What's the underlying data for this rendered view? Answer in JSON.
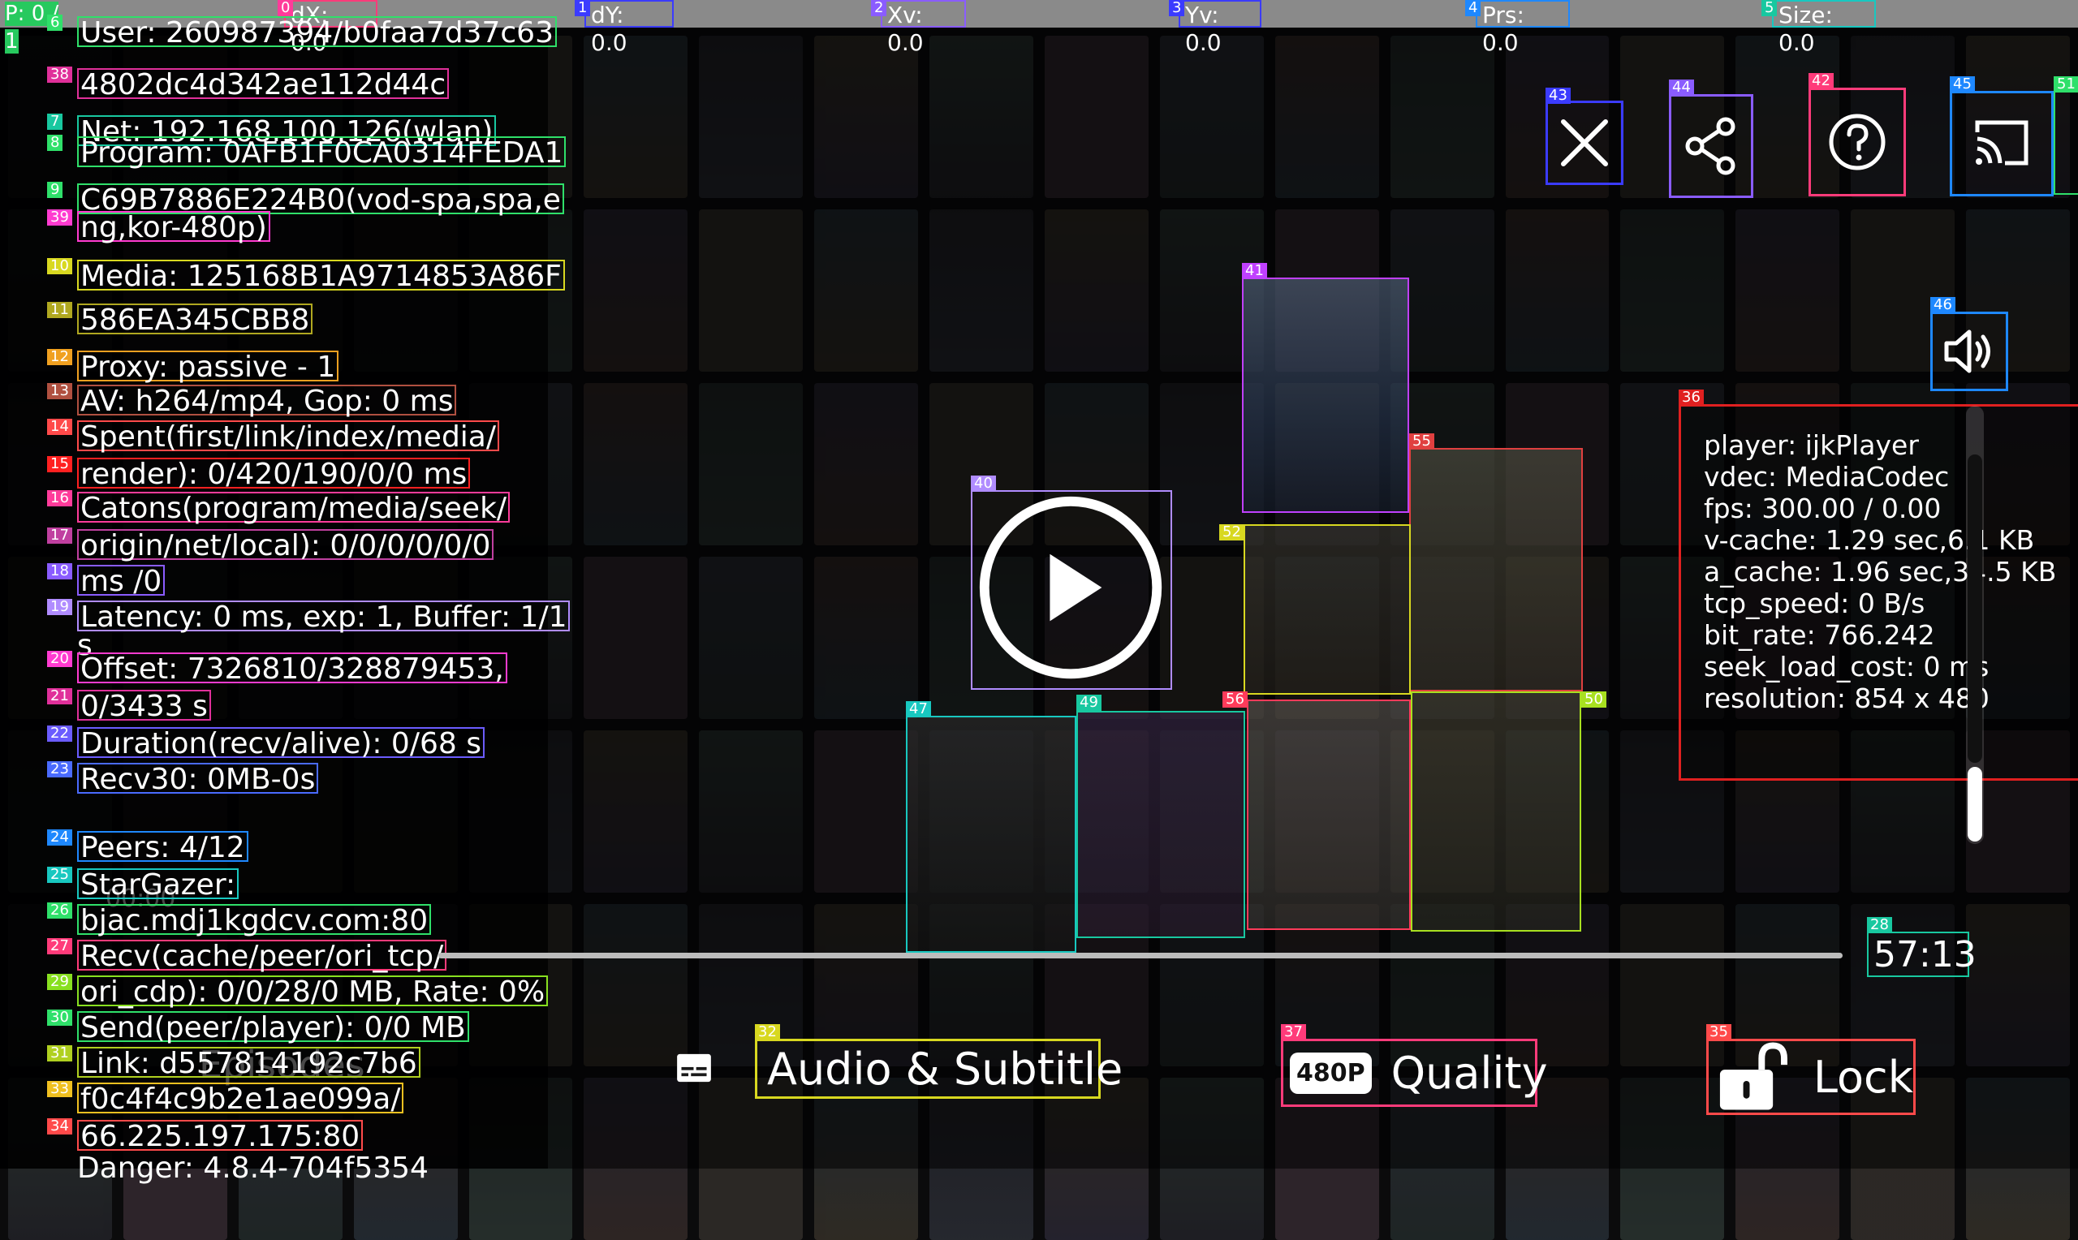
{
  "topbar": {
    "p_label": "P: 0 / 1",
    "coords": [
      {
        "id": "0",
        "label": "dX: 0.0"
      },
      {
        "id": "1",
        "label": "dY: 0.0"
      },
      {
        "id": "2",
        "label": "Xv: 0.0"
      },
      {
        "id": "3",
        "label": "Yv: 0.0"
      },
      {
        "id": "4",
        "label": "Prs: 0.0"
      },
      {
        "id": "5",
        "label": "Size: 0.0"
      }
    ]
  },
  "debug_lines": [
    {
      "id": "6",
      "text": "User: 260987394/b0faa7d37c63"
    },
    {
      "id": "38",
      "text": "4802dc4d342ae112d44c"
    },
    {
      "id": "7",
      "text": "Net: 192.168.100.126(wlan)"
    },
    {
      "id": "8",
      "text": "Program: 0AFB1F0CA0314FEDA1"
    },
    {
      "id": "9",
      "text": "C69B7886E224B0(vod-spa,spa,e"
    },
    {
      "id": "39",
      "text": "ng,kor-480p)"
    },
    {
      "id": "10",
      "text": "Media: 125168B1A9714853A86F"
    },
    {
      "id": "11",
      "text": "586EA345CBB8"
    },
    {
      "id": "12",
      "text": "Proxy: passive - 1"
    },
    {
      "id": "13",
      "text": "AV: h264/mp4, Gop: 0 ms"
    },
    {
      "id": "14",
      "text": "Spent(first/link/index/media/"
    },
    {
      "id": "15",
      "text": "render): 0/420/190/0/0 ms"
    },
    {
      "id": "16",
      "text": "Catons(program/media/seek/"
    },
    {
      "id": "17",
      "text": "origin/net/local): 0/0/0/0/0/0"
    },
    {
      "id": "18",
      "text": "ms /0"
    },
    {
      "id": "19",
      "text": "Latency: 0 ms, exp: 1, Buffer: 1/1"
    },
    {
      "id": "19b",
      "text": "s"
    },
    {
      "id": "20",
      "text": "Offset: 7326810/328879453,"
    },
    {
      "id": "21",
      "text": "0/3433 s"
    },
    {
      "id": "22",
      "text": "Duration(recv/alive): 0/68 s"
    },
    {
      "id": "23",
      "text": "Recv30: 0MB-0s"
    },
    {
      "id": "24",
      "text": "Peers: 4/12"
    },
    {
      "id": "25",
      "text": "StarGazer:"
    },
    {
      "id": "26",
      "text": "bjac.mdj1kgdcv.com:80"
    },
    {
      "id": "27",
      "text": "Recv(cache/peer/ori_tcp/"
    },
    {
      "id": "29",
      "text": "ori_cdp): 0/0/28/0 MB, Rate: 0%"
    },
    {
      "id": "30",
      "text": "Send(peer/player): 0/0 MB"
    },
    {
      "id": "31",
      "text": "Link: d557814192c7b6"
    },
    {
      "id": "33",
      "text": "f0c4f4c9b2e1ae099a/"
    },
    {
      "id": "34",
      "text": "66.225.197.175:80"
    },
    {
      "id": "34b",
      "text": "Danger: 4.8.4-704f5354"
    }
  ],
  "ghost_texts": {
    "episodes": "Episodes",
    "time_start": "00:00"
  },
  "info_panel": {
    "id": "36",
    "lines": [
      "player: ijkPlayer",
      "vdec: MediaCodec",
      "fps: 300.00 / 0.00",
      "v-cache: 1.29 sec,6.1 KB",
      "a_cache: 1.96 sec,34.5 KB",
      "tcp_speed: 0 B/s",
      "bit_rate: 766.242",
      "seek_load_cost: 0 ms",
      "resolution: 854 x 480"
    ]
  },
  "top_buttons": [
    {
      "id": "43",
      "name": "close-icon"
    },
    {
      "id": "44",
      "name": "share-icon"
    },
    {
      "id": "42",
      "name": "help-icon"
    },
    {
      "id": "45",
      "name": "cast-icon"
    },
    {
      "id": "51",
      "name": "more-icon"
    }
  ],
  "volume_button": {
    "id": "46"
  },
  "play_button": {
    "id": "40"
  },
  "grid_ids": {
    "p41": "41",
    "p55": "55",
    "p52": "52",
    "p47": "47",
    "p49": "49",
    "p56": "56",
    "p50": "50"
  },
  "progress": {
    "duration": "57:13",
    "duration_id": "28",
    "played_fraction": 0.0
  },
  "controls": {
    "audio_subtitle": {
      "id": "32",
      "label": "Audio & Subtitle"
    },
    "quality": {
      "id": "37",
      "label": "Quality",
      "badge": "480P"
    },
    "lock": {
      "id": "35",
      "label": "Lock"
    }
  },
  "colors": {
    "accent_green": "#2fe06a",
    "accent_red": "#e02020",
    "accent_blue": "#2f6bff"
  }
}
